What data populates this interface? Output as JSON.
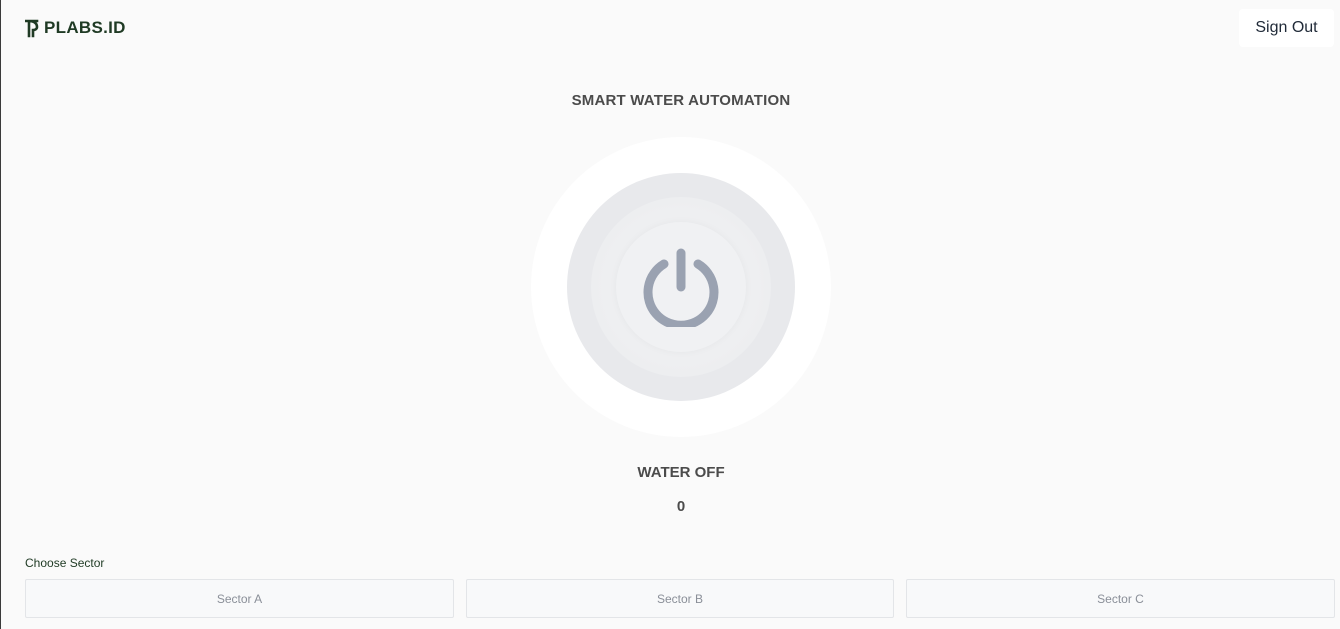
{
  "header": {
    "logo_text": "PLABS.ID",
    "signout_label": "Sign Out"
  },
  "main": {
    "title": "SMART WATER AUTOMATION",
    "status": "WATER OFF",
    "count": "0",
    "power_icon": "power-icon"
  },
  "sectors": {
    "label": "Choose Sector",
    "items": [
      {
        "label": "Sector A"
      },
      {
        "label": "Sector B"
      },
      {
        "label": "Sector C"
      }
    ]
  },
  "colors": {
    "background": "#fafafa",
    "brand": "#1f3a24",
    "power_icon": "#9aa2b1",
    "button_bg": "#e8e9ec"
  }
}
